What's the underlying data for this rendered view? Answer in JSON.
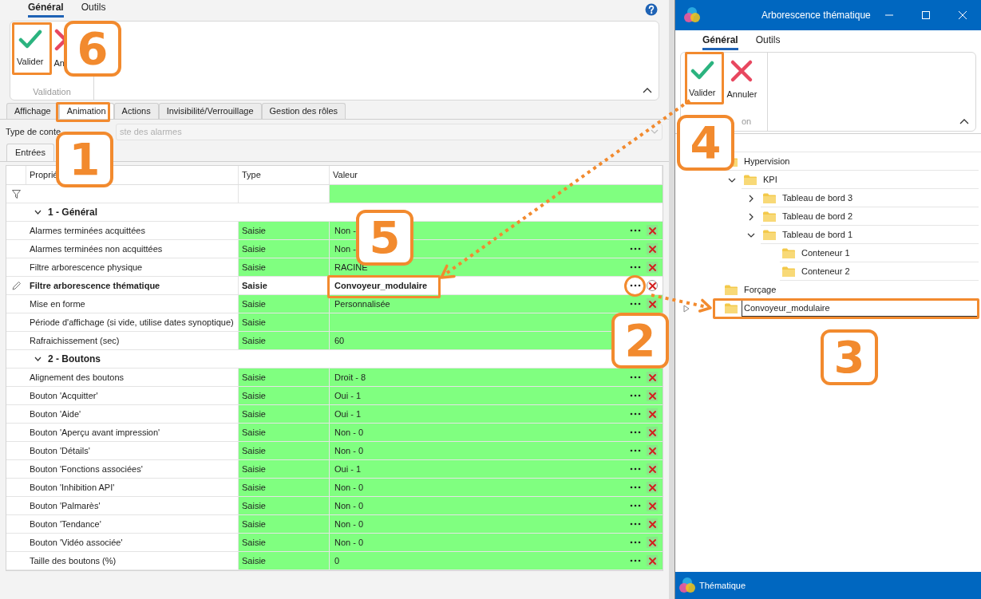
{
  "editor": {
    "ribbon_tabs": [
      {
        "label": "Général",
        "selected": true
      },
      {
        "label": "Outils",
        "selected": false
      }
    ],
    "ribbon_buttons": [
      {
        "kind": "validate",
        "label": "Valider"
      },
      {
        "kind": "cancel",
        "label": "An"
      }
    ],
    "ribbon_group": "Validation",
    "tabs": [
      {
        "label": "Affichage",
        "selected": false
      },
      {
        "label": "Animation",
        "selected": true
      },
      {
        "label": "Actions",
        "selected": false
      },
      {
        "label": "Invisibilité/Verrouillage",
        "selected": false
      },
      {
        "label": "Gestion des rôles",
        "selected": false
      }
    ],
    "content_type": {
      "label": "Type de conte",
      "value": "ste des alarmes"
    },
    "subtabs": [
      {
        "label": "Entrées",
        "selected": true
      }
    ],
    "table": {
      "columns": [
        "Proprié",
        "Type",
        "Valeur"
      ],
      "rows": [
        {
          "kind": "group",
          "label": "1 - Général",
          "expanded": true
        },
        {
          "kind": "property",
          "property": "Alarmes terminées acquittées",
          "type": "Saisie",
          "value": "Non -",
          "editing": false
        },
        {
          "kind": "property",
          "property": "Alarmes terminées non acquittées",
          "type": "Saisie",
          "value": "Non -",
          "editing": false
        },
        {
          "kind": "property",
          "property": "Filtre arborescence physique",
          "type": "Saisie",
          "value": "RACINE",
          "editing": false
        },
        {
          "kind": "property",
          "property": "Filtre arborescence thématique",
          "type": "Saisie",
          "value": "Convoyeur_modulaire",
          "editing": true
        },
        {
          "kind": "property",
          "property": "Mise en forme",
          "type": "Saisie",
          "value": "Personnalisée",
          "editing": false
        },
        {
          "kind": "property",
          "property": "Période d'affichage (si vide, utilise dates synoptique)",
          "type": "Saisie",
          "editing": false
        },
        {
          "kind": "property",
          "property": "Rafraichissement (sec)",
          "type": "Saisie",
          "value": "60",
          "editing": false
        },
        {
          "kind": "group",
          "label": "2 - Boutons",
          "expanded": true
        },
        {
          "kind": "property",
          "property": "Alignement des boutons",
          "type": "Saisie",
          "value": "Droit - 8",
          "editing": false
        },
        {
          "kind": "property",
          "property": "Bouton 'Acquitter'",
          "type": "Saisie",
          "value": "Oui - 1",
          "editing": false
        },
        {
          "kind": "property",
          "property": "Bouton 'Aide'",
          "type": "Saisie",
          "value": "Oui - 1",
          "editing": false
        },
        {
          "kind": "property",
          "property": "Bouton 'Aperçu avant impression'",
          "type": "Saisie",
          "value": "Non - 0",
          "editing": false
        },
        {
          "kind": "property",
          "property": "Bouton 'Détails'",
          "type": "Saisie",
          "value": "Non - 0",
          "editing": false
        },
        {
          "kind": "property",
          "property": "Bouton 'Fonctions associées'",
          "type": "Saisie",
          "value": "Oui - 1",
          "editing": false
        },
        {
          "kind": "property",
          "property": "Bouton 'Inhibition API'",
          "type": "Saisie",
          "value": "Non - 0",
          "editing": false
        },
        {
          "kind": "property",
          "property": "Bouton 'Palmarès'",
          "type": "Saisie",
          "value": "Non - 0",
          "editing": false
        },
        {
          "kind": "property",
          "property": "Bouton 'Tendance'",
          "type": "Saisie",
          "value": "Non - 0",
          "editing": false
        },
        {
          "kind": "property",
          "property": "Bouton 'Vidéo associée'",
          "type": "Saisie",
          "value": "Non - 0",
          "editing": false
        },
        {
          "kind": "property",
          "property": "Taille des boutons (%)",
          "type": "Saisie",
          "value": "0",
          "editing": false
        }
      ]
    }
  },
  "tree_window": {
    "title": "Arborescence thématique",
    "ribbon_tabs": [
      {
        "label": "Général",
        "selected": true
      },
      {
        "label": "Outils",
        "selected": false
      }
    ],
    "ribbon_buttons": [
      {
        "kind": "validate",
        "label": "Valider"
      },
      {
        "kind": "cancel",
        "label": "Annuler"
      }
    ],
    "ribbon_group": "on",
    "tree": [
      {
        "label": "Hypervision",
        "selected": false,
        "children": [
          {
            "label": "KPI",
            "expanded": true,
            "selected": false,
            "children": [
              {
                "label": "Tableau de bord 3",
                "expanded": false,
                "selected": false
              },
              {
                "label": "Tableau de bord 2",
                "expanded": false,
                "selected": false
              },
              {
                "label": "Tableau de bord 1",
                "expanded": true,
                "selected": false,
                "children": [
                  {
                    "label": "Conteneur 1",
                    "selected": false
                  },
                  {
                    "label": "Conteneur 2",
                    "selected": false
                  }
                ]
              }
            ]
          }
        ]
      },
      {
        "label": "Forçage",
        "selected": false
      },
      {
        "label": "Convoyeur_modulaire",
        "selected": true
      }
    ],
    "status": "Thématique"
  },
  "callouts": [
    {
      "label": "6"
    },
    {
      "label": "1"
    },
    {
      "label": "5"
    },
    {
      "label": "2"
    },
    {
      "label": "3"
    },
    {
      "label": "4"
    }
  ]
}
